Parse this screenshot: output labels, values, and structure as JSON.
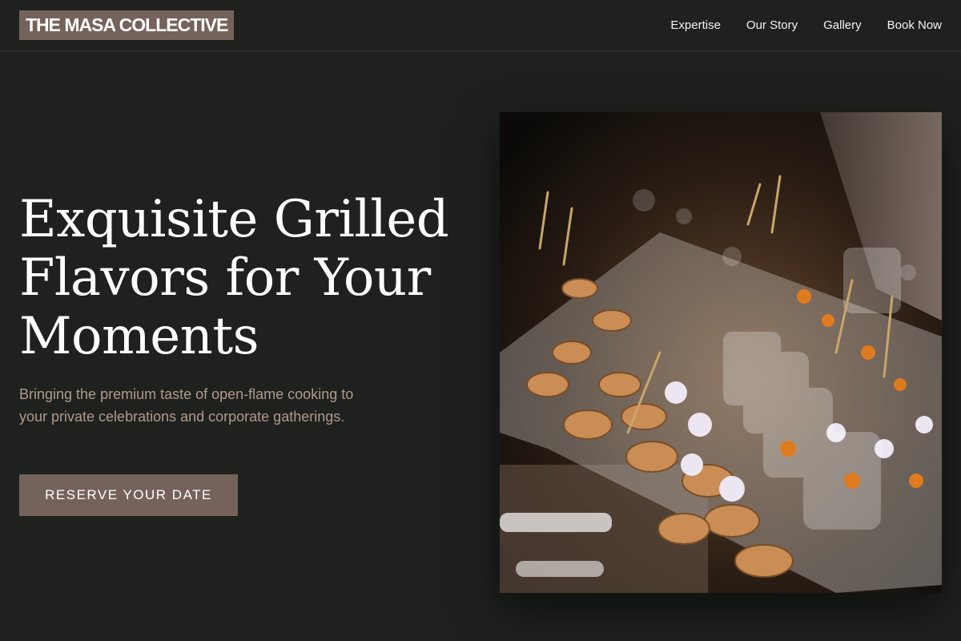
{
  "header": {
    "logo": "THE MASA COLLECTIVE",
    "nav": [
      "Expertise",
      "Our Story",
      "Gallery",
      "Book Now"
    ]
  },
  "hero": {
    "title": "Exquisite Grilled Flavors for Your Moments",
    "subtitle": "Bringing the premium taste of open-flame cooking to your private celebrations and corporate gatherings.",
    "cta": "RESERVE YOUR DATE"
  },
  "colors": {
    "background": "#1e211e",
    "accent": "#75625a",
    "subtitle": "#b09a8c"
  }
}
